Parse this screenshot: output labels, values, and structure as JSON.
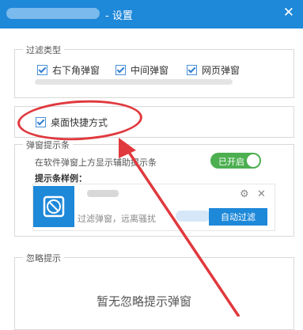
{
  "window": {
    "title": "- 设置",
    "close": "✕"
  },
  "filter": {
    "legend": "过滤类型",
    "options": [
      "右下角弹窗",
      "中间弹窗",
      "网页弹窗"
    ],
    "desktop_shortcut": "桌面快捷方式"
  },
  "popup_tip": {
    "legend": "弹窗提示条",
    "desc": "在软件弹窗上方显示辅助提示条",
    "toggle_label": "已开启",
    "sample_label": "提示条样例：",
    "sample_text": "过滤弹窗，远离骚扰",
    "auto_filter_button": "自动过滤",
    "gear": "⚙",
    "close": "✕"
  },
  "ignore": {
    "legend": "忽略提示",
    "empty_text": "暂无忽略提示弹窗"
  },
  "colors": {
    "title_bar": "#1e88d9",
    "toggle_on": "#4caf50",
    "annotation": "#e0393e"
  }
}
